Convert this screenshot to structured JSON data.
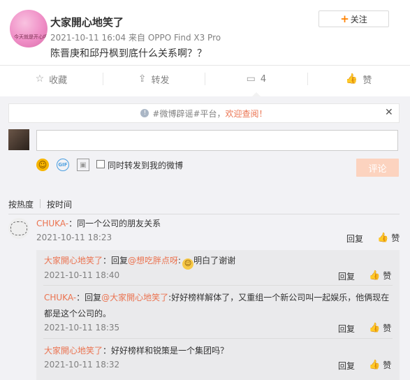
{
  "post": {
    "author": "大家開心地笑了",
    "avatar_caption": "今天就是开心呀",
    "timestamp": "2021-10-11 16:04",
    "source_prefix": "来自",
    "source_device": "OPPO Find X3 Pro",
    "text": "陈晋庚和邱丹枫到底什么关系啊？？",
    "follow_label": "关注"
  },
  "actions": {
    "favorite": "收藏",
    "repost": "转发",
    "comment_count": "4",
    "like": "赞"
  },
  "notice": {
    "hashtag": "#微博辟谣#平台，",
    "link": "欢迎查阅！"
  },
  "composer": {
    "input_value": "",
    "checkbox_label": "同时转发到我的微博",
    "submit_label": "评论"
  },
  "sort": {
    "by_heat": "按热度",
    "by_time": "按时间"
  },
  "comments": [
    {
      "author": "CHUKA-",
      "text": "：同一个公司的朋友关系",
      "time": "2021-10-11 18:23",
      "reply_label": "回复",
      "like_label": "赞",
      "replies": [
        {
          "author": "大家開心地笑了",
          "pre": "：回复",
          "mention": "@想吃胖点呀",
          "post": ":",
          "emoji": "face-icon",
          "tail": "明白了谢谢",
          "time": "2021-10-11 18:40",
          "reply_label": "回复",
          "like_label": "赞"
        },
        {
          "author": "CHUKA-",
          "pre": "：回复",
          "mention": "@大家開心地笑了",
          "post": ":好好榜样解体了，又重组一个新公司叫一起娱乐，他俩现在",
          "line2": "都是这个公司的。",
          "time": "2021-10-11 18:35",
          "reply_label": "回复",
          "like_label": "赞"
        },
        {
          "author": "大家開心地笑了",
          "pre": "：好好榜样和锐策是一个集团吗？",
          "time": "2021-10-11 18:32",
          "reply_label": "回复",
          "like_label": "赞"
        }
      ]
    }
  ]
}
